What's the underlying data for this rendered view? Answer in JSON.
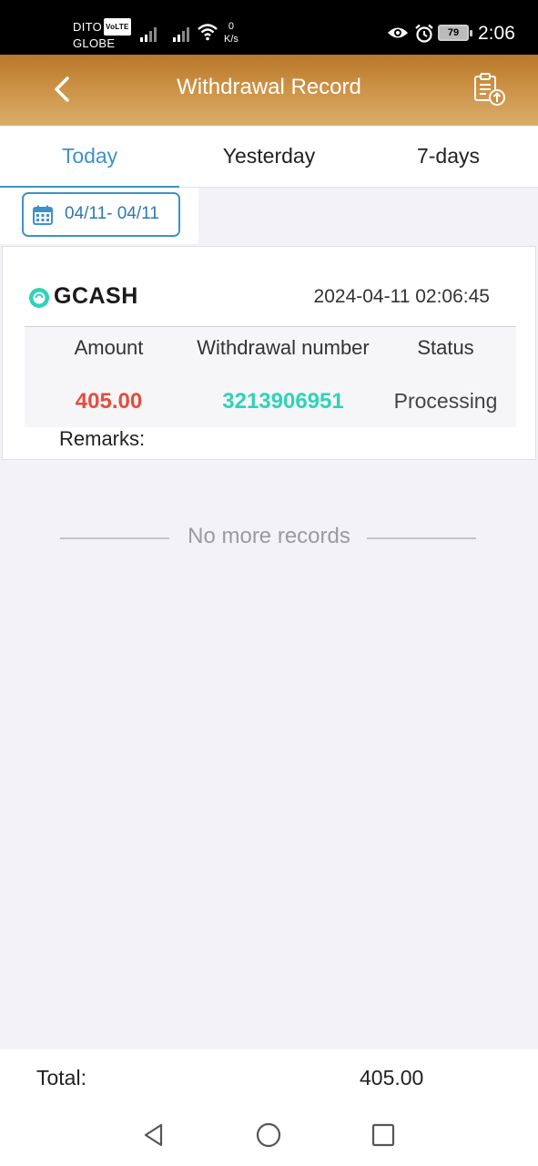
{
  "status_bar": {
    "carrier_1": "DITO",
    "volte": "VoLTE",
    "carrier_2": "GLOBE",
    "net_speed_value": "0",
    "net_speed_unit": "K/s",
    "battery": "79",
    "time": "2:06"
  },
  "header": {
    "title": "Withdrawal Record",
    "back_icon": "chevron-left-icon",
    "action_icon": "clipboard-upload-icon"
  },
  "tabs": [
    {
      "label": "Today",
      "active": true
    },
    {
      "label": "Yesterday",
      "active": false
    },
    {
      "label": "7-days",
      "active": false
    }
  ],
  "date_filter": {
    "icon": "calendar-icon",
    "range": "04/11- 04/11"
  },
  "records": [
    {
      "method": "GCASH",
      "datetime": "2024-04-11 02:06:45",
      "headers": {
        "amount": "Amount",
        "number": "Withdrawal number",
        "status": "Status"
      },
      "amount": "405.00",
      "number": "3213906951",
      "status": "Processing",
      "remarks_label": "Remarks:"
    }
  ],
  "no_more": "No more records",
  "footer": {
    "total_label": "Total:",
    "total_value": "405.00"
  },
  "colors": {
    "header_gradient_top": "#b8772a",
    "header_gradient_bottom": "#d9ad6b",
    "accent": "#3d92c9",
    "amount": "#e74c3c",
    "withdrawal_number": "#2fd3b6",
    "background": "#f2f2f8"
  }
}
